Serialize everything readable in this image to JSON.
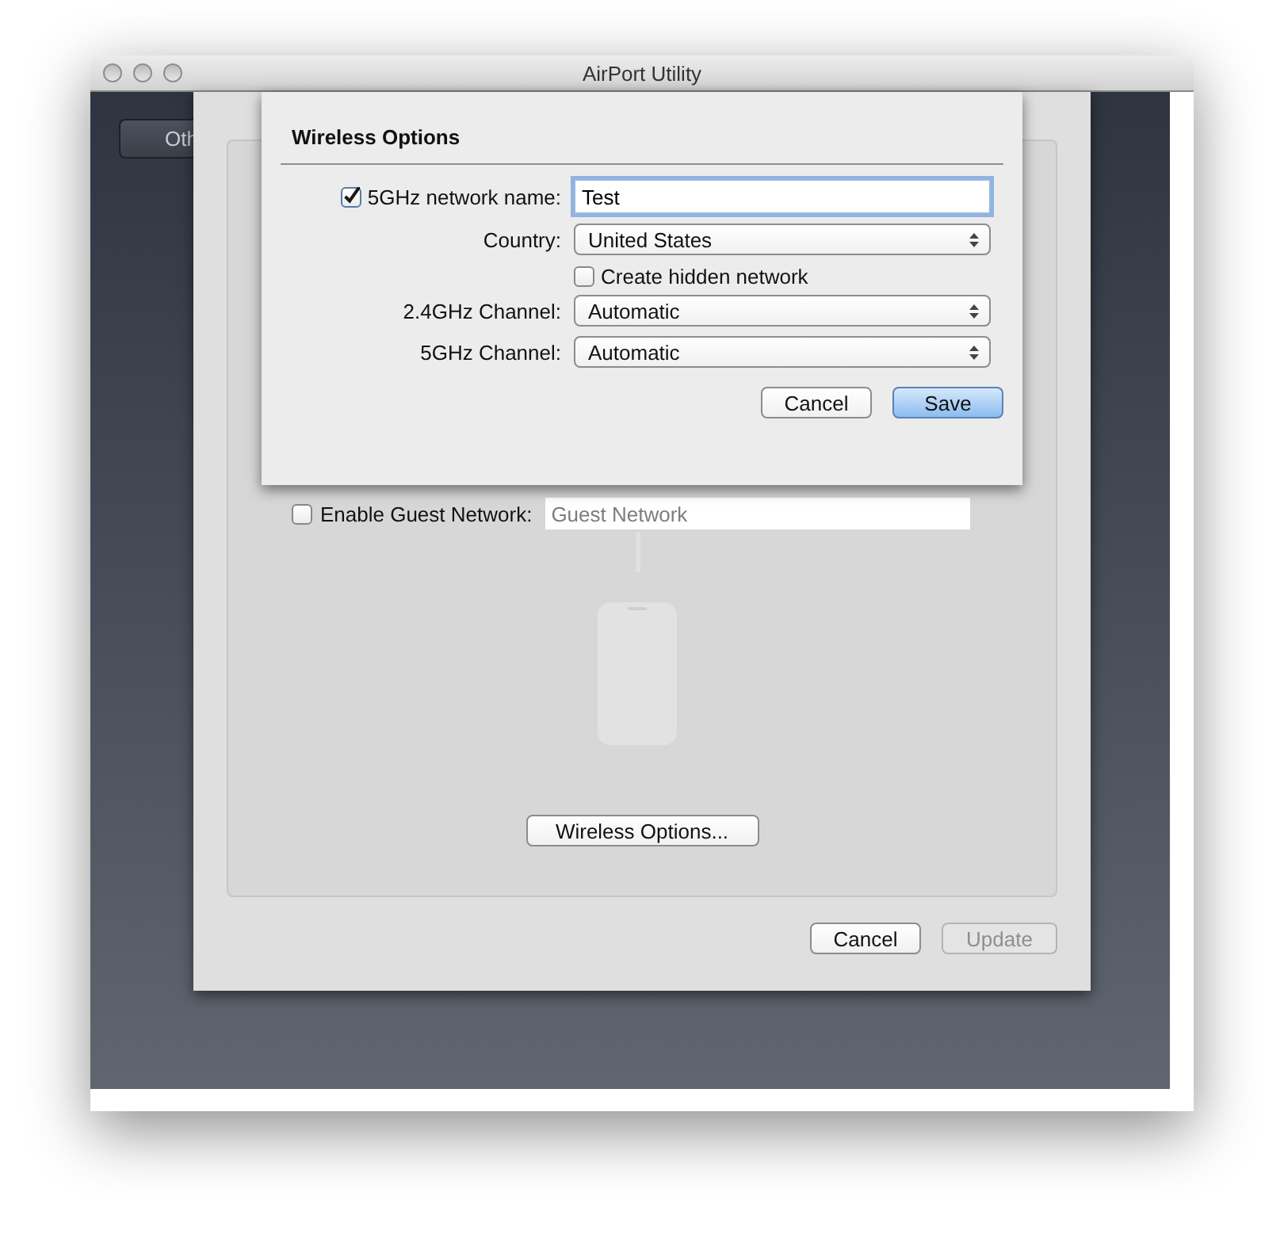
{
  "window": {
    "title": "AirPort Utility"
  },
  "background": {
    "other_button": "Oth"
  },
  "settings_sheet": {
    "guest_network": {
      "label": "Enable Guest Network:",
      "checked": false,
      "placeholder": "Guest Network"
    },
    "wireless_options_button": "Wireless Options...",
    "buttons": [
      {
        "label": "Cancel",
        "disabled": false
      },
      {
        "label": "Update",
        "disabled": true
      }
    ]
  },
  "wireless_options": {
    "title": "Wireless Options",
    "network_name": {
      "label": "5GHz network name:",
      "checked": true,
      "value": "Test"
    },
    "country": {
      "label": "Country:",
      "value": "United States"
    },
    "hidden_network": {
      "label": "Create hidden network",
      "checked": false
    },
    "channels": [
      {
        "label": "2.4GHz Channel:",
        "value": "Automatic"
      },
      {
        "label": "5GHz Channel:",
        "value": "Automatic"
      }
    ],
    "buttons": [
      {
        "label": "Cancel",
        "default": false
      },
      {
        "label": "Save",
        "default": true
      }
    ]
  }
}
